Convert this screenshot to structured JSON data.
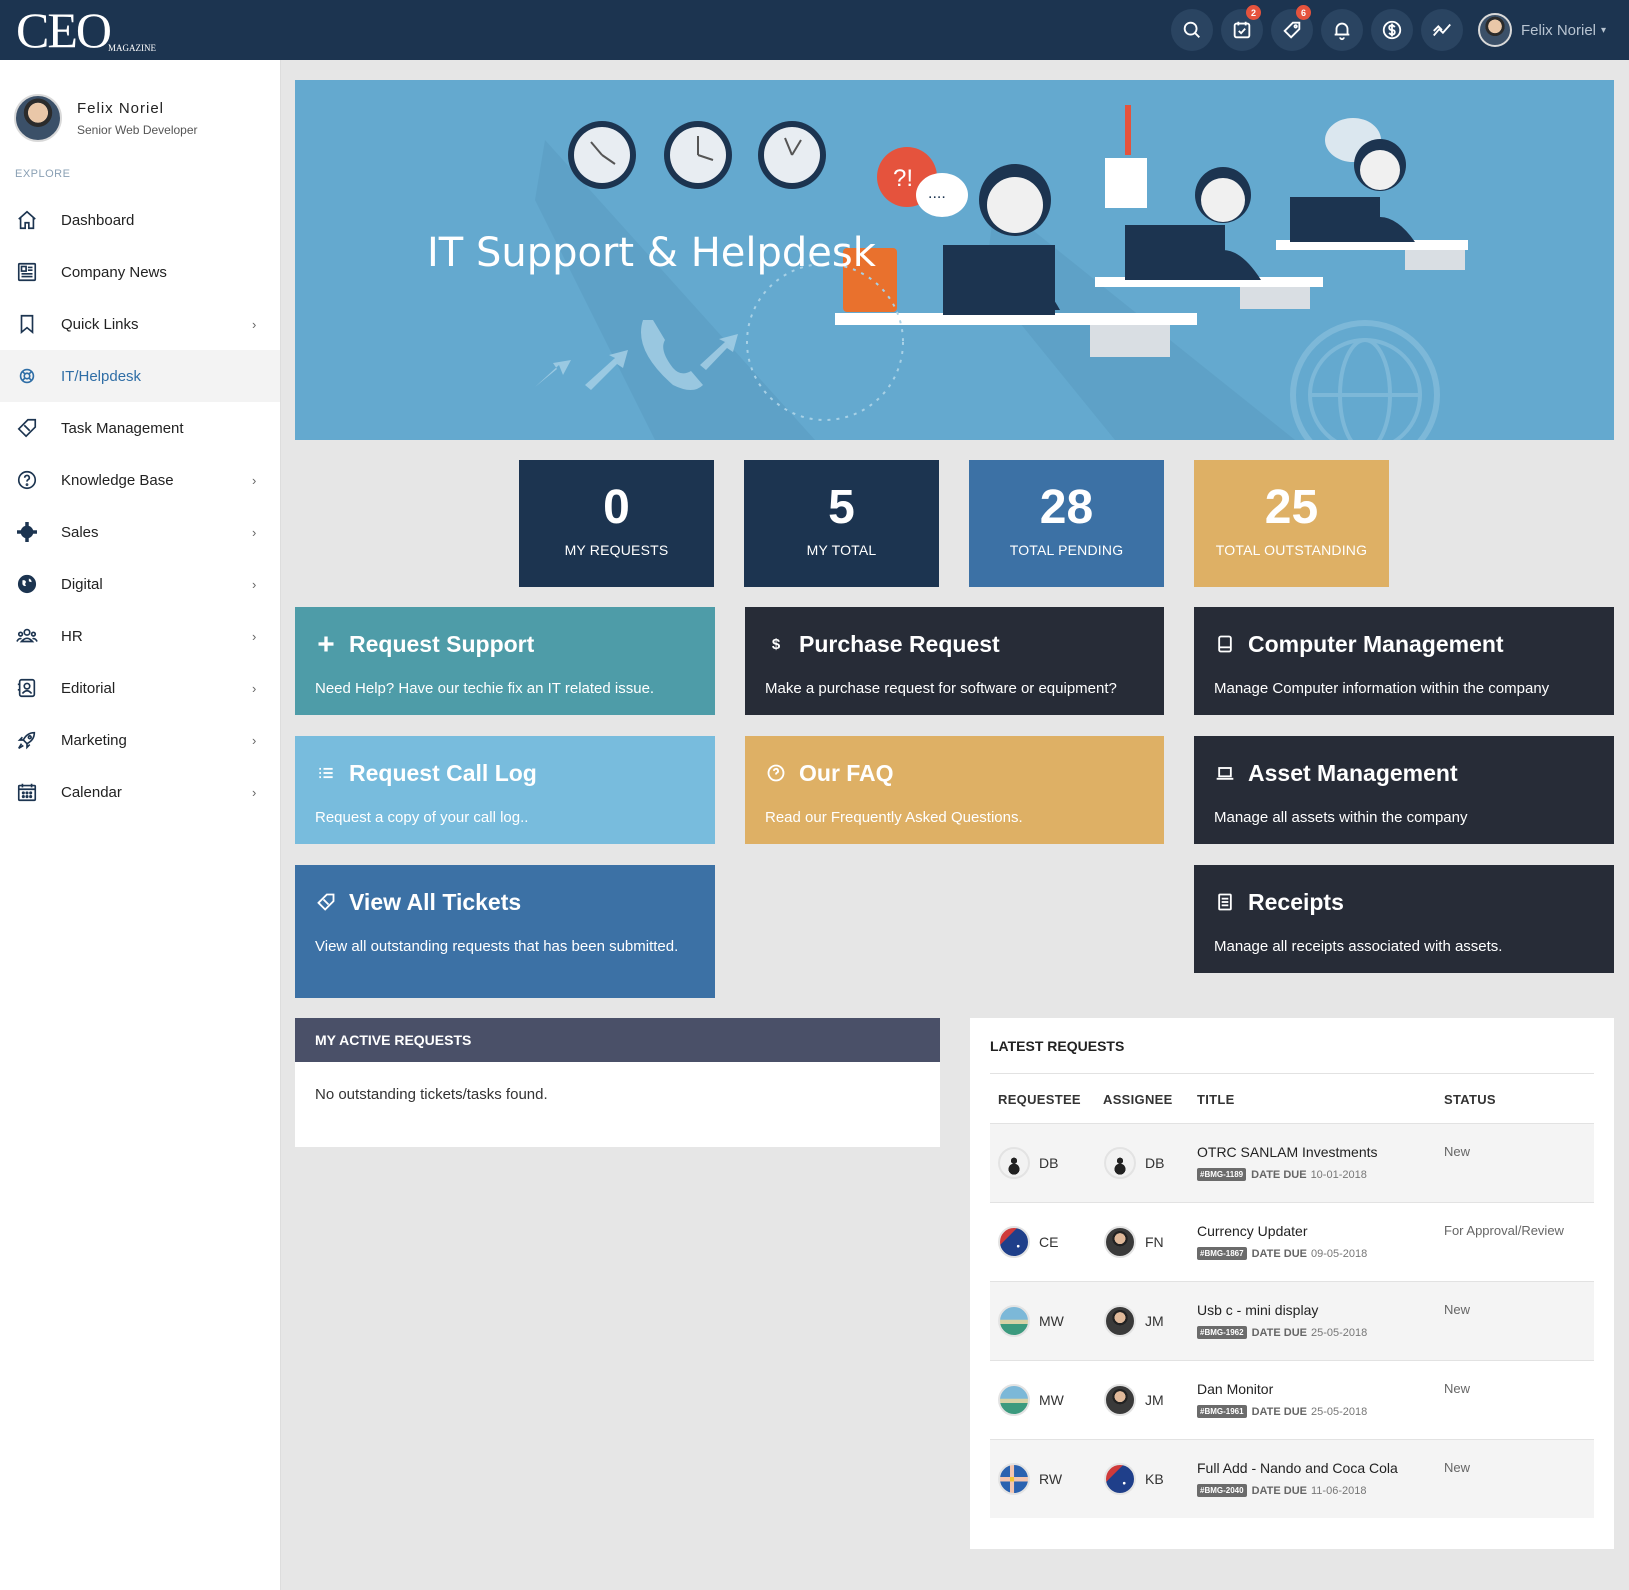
{
  "brand": {
    "logo": "CEO",
    "logo_sub": "MAGAZINE"
  },
  "topbar": {
    "icons": [
      {
        "name": "search-icon",
        "badge": ""
      },
      {
        "name": "calendar-check-icon",
        "badge": "2"
      },
      {
        "name": "ticket-icon",
        "badge": "6"
      },
      {
        "name": "bell-icon",
        "badge": ""
      },
      {
        "name": "dollar-icon",
        "badge": ""
      },
      {
        "name": "analytics-icon",
        "badge": ""
      }
    ],
    "user_name": "Felix Noriel",
    "caret": "▾"
  },
  "sidebar": {
    "profile": {
      "name": "Felix Noriel",
      "role": "Senior Web Developer"
    },
    "section_label": "EXPLORE",
    "items": [
      {
        "label": "Dashboard",
        "icon": "home-icon",
        "has_children": false,
        "active": false
      },
      {
        "label": "Company News",
        "icon": "newspaper-icon",
        "has_children": false,
        "active": false
      },
      {
        "label": "Quick Links",
        "icon": "bookmark-icon",
        "has_children": true,
        "active": false
      },
      {
        "label": "IT/Helpdesk",
        "icon": "lifebuoy-icon",
        "has_children": false,
        "active": true
      },
      {
        "label": "Task Management",
        "icon": "tag-icon",
        "has_children": false,
        "active": false
      },
      {
        "label": "Knowledge Base",
        "icon": "question-icon",
        "has_children": true,
        "active": false
      },
      {
        "label": "Sales",
        "icon": "cog-icon",
        "has_children": true,
        "active": false
      },
      {
        "label": "Digital",
        "icon": "globe-icon",
        "has_children": true,
        "active": false
      },
      {
        "label": "HR",
        "icon": "people-icon",
        "has_children": true,
        "active": false
      },
      {
        "label": "Editorial",
        "icon": "contact-icon",
        "has_children": true,
        "active": false
      },
      {
        "label": "Marketing",
        "icon": "rocket-icon",
        "has_children": true,
        "active": false
      },
      {
        "label": "Calendar",
        "icon": "calendar-icon",
        "has_children": true,
        "active": false
      }
    ],
    "chevron": "›"
  },
  "hero": {
    "title": "IT Support & Helpdesk"
  },
  "stats": [
    {
      "value": "0",
      "label": "MY REQUESTS",
      "color": "#1c3450"
    },
    {
      "value": "5",
      "label": "MY TOTAL",
      "color": "#1c3450"
    },
    {
      "value": "28",
      "label": "TOTAL PENDING",
      "color": "#3c71a5"
    },
    {
      "value": "25",
      "label": "TOTAL OUTSTANDING",
      "color": "#deb065"
    }
  ],
  "tiles": {
    "request_support": {
      "title": "Request Support",
      "desc": "Need Help? Have our techie fix an IT related issue.",
      "icon": "+"
    },
    "purchase_request": {
      "title": "Purchase Request",
      "desc": "Make a purchase request for software or equipment?",
      "icon": "$"
    },
    "computer_management": {
      "title": "Computer Management",
      "desc": "Manage Computer information within the company"
    },
    "request_call_log": {
      "title": "Request Call Log",
      "desc": "Request a copy of your call log.."
    },
    "our_faq": {
      "title": "Our FAQ",
      "desc": "Read our Frequently Asked Questions."
    },
    "asset_management": {
      "title": "Asset Management",
      "desc": "Manage all assets within the company"
    },
    "view_all_tickets": {
      "title": "View All Tickets",
      "desc": "View all outstanding requests that has been submitted."
    },
    "receipts": {
      "title": "Receipts",
      "desc": "Manage all receipts associated with assets."
    }
  },
  "active_requests": {
    "title": "MY ACTIVE REQUESTS",
    "empty": "No outstanding tickets/tasks found."
  },
  "latest_requests": {
    "title": "LATEST REQUESTS",
    "columns": [
      "REQUESTEE",
      "ASSIGNEE",
      "TITLE",
      "STATUS"
    ],
    "due_label": "DATE DUE",
    "rows": [
      {
        "requestee": "DB",
        "requestee_avatar": "faceless",
        "assignee": "DB",
        "assignee_avatar": "faceless",
        "title": "OTRC SANLAM Investments",
        "tag": "#BMG-1189",
        "due": "10-01-2018",
        "status": "New"
      },
      {
        "requestee": "CE",
        "requestee_avatar": "au",
        "assignee": "FN",
        "assignee_avatar": "man",
        "title": "Currency Updater",
        "tag": "#BMG-1867",
        "due": "09-05-2018",
        "status": "For Approval/Review"
      },
      {
        "requestee": "MW",
        "requestee_avatar": "beach",
        "assignee": "JM",
        "assignee_avatar": "man",
        "title": "Usb c - mini display",
        "tag": "#BMG-1962",
        "due": "25-05-2018",
        "status": "New"
      },
      {
        "requestee": "MW",
        "requestee_avatar": "beach",
        "assignee": "JM",
        "assignee_avatar": "man",
        "title": "Dan Monitor",
        "tag": "#BMG-1961",
        "due": "25-05-2018",
        "status": "New"
      },
      {
        "requestee": "RW",
        "requestee_avatar": "se",
        "assignee": "KB",
        "assignee_avatar": "au",
        "title": "Full Add - Nando and Coca Cola",
        "tag": "#BMG-2040",
        "due": "11-06-2018",
        "status": "New"
      }
    ]
  }
}
